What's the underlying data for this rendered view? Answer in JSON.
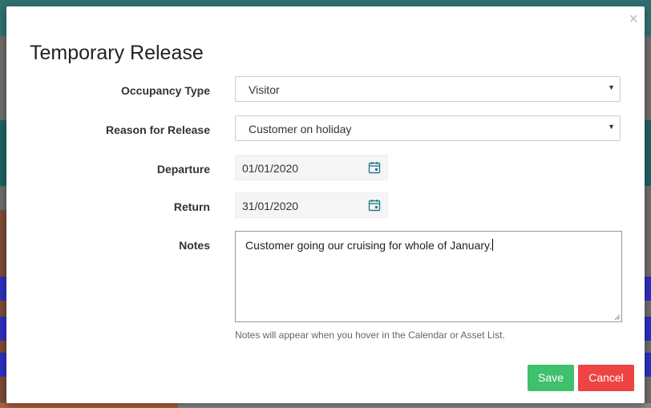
{
  "modal": {
    "title": "Temporary Release",
    "close_symbol": "×"
  },
  "form": {
    "occupancy_type": {
      "label": "Occupancy Type",
      "value": "Visitor"
    },
    "reason_for_release": {
      "label": "Reason for Release",
      "value": "Customer on holiday"
    },
    "departure": {
      "label": "Departure",
      "value": "01/01/2020"
    },
    "return": {
      "label": "Return",
      "value": "31/01/2020"
    },
    "notes": {
      "label": "Notes",
      "value": "Customer going our cruising for whole of January.",
      "help": "Notes will appear when you hover in the Calendar or Asset List."
    }
  },
  "actions": {
    "save_label": "Save",
    "cancel_label": "Cancel"
  },
  "icons": {
    "calendar": "calendar-icon",
    "caret": "chevron-down-icon",
    "close": "close-icon",
    "resize": "resize-handle-icon"
  },
  "colors": {
    "save": "#3fc06a",
    "cancel": "#ee4444",
    "calendar_icon": "#2a7a8a"
  }
}
